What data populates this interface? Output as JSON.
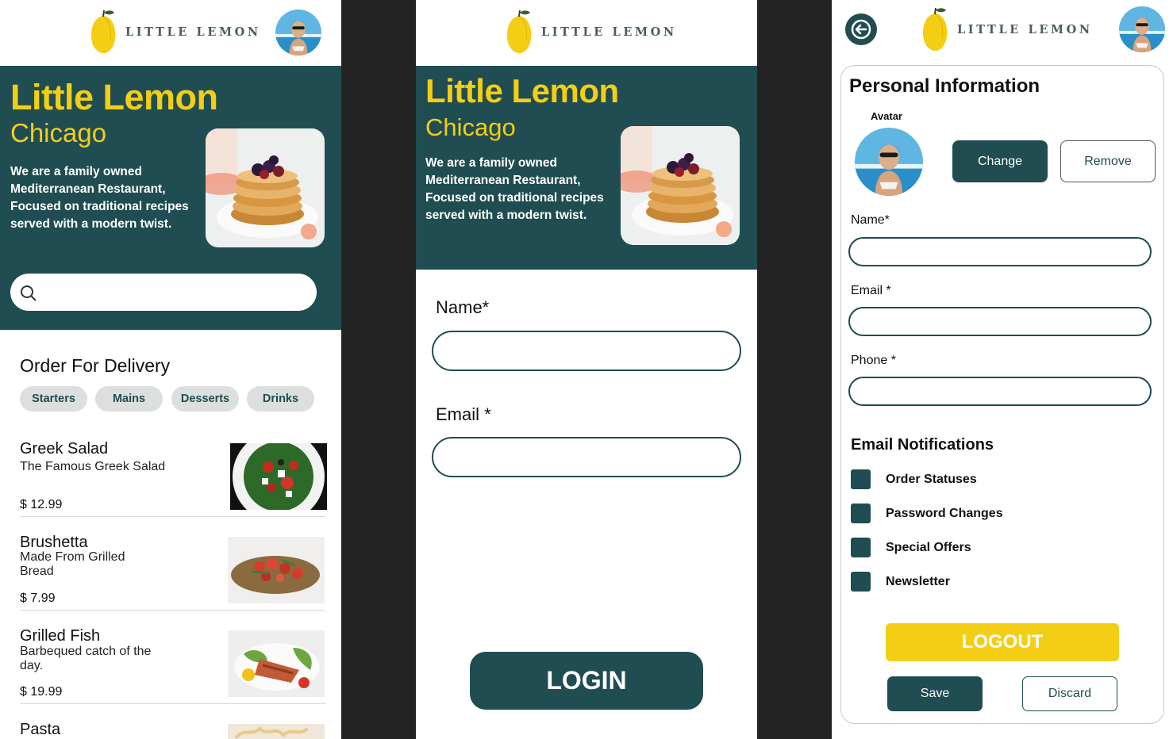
{
  "brand": {
    "logo_text": "LITTLE LEMON",
    "colors": {
      "primary": "#1f4d52",
      "accent": "#f4ce14",
      "light": "#dcdfde"
    }
  },
  "home": {
    "hero": {
      "title": "Little Lemon",
      "subtitle": "Chicago",
      "description": "We are a family owned Mediterranean Restaurant, Focused on traditional recipes served with  a modern twist."
    },
    "search": {
      "placeholder": "",
      "icon": "search-icon"
    },
    "section_title": "Order For Delivery",
    "categories": [
      "Starters",
      "Mains",
      "Desserts",
      "Drinks"
    ],
    "menu": [
      {
        "name": "Greek Salad",
        "description": "The Famous Greek Salad",
        "price": "$ 12.99"
      },
      {
        "name": "Brushetta",
        "description": "Made From Grilled Bread",
        "price": "$ 7.99"
      },
      {
        "name": "Grilled Fish",
        "description": "Barbequed catch of the day.",
        "price": "$ 19.99"
      },
      {
        "name": "Pasta",
        "description": "",
        "price": ""
      }
    ]
  },
  "onboarding": {
    "hero": {
      "title": "Little Lemon",
      "subtitle": "Chicago",
      "description": "We are a family owned Mediterranean Restaurant, Focused on traditional recipes served with  a modern twist."
    },
    "name_label": "Name*",
    "email_label": "Email *",
    "name_value": "",
    "email_value": "",
    "login_label": "LOGIN"
  },
  "profile": {
    "back_icon": "arrow-left-icon",
    "title": "Personal Information",
    "avatar_label": "Avatar",
    "change_label": "Change",
    "remove_label": "Remove",
    "name_label": "Name*",
    "email_label": "Email *",
    "phone_label": "Phone *",
    "name_value": "",
    "email_value": "",
    "phone_value": "",
    "notifications_title": "Email Notifications",
    "notifications": [
      {
        "label": "Order Statuses",
        "checked": true
      },
      {
        "label": "Password Changes",
        "checked": true
      },
      {
        "label": "Special Offers",
        "checked": true
      },
      {
        "label": "Newsletter",
        "checked": true
      }
    ],
    "logout_label": "LOGOUT",
    "save_label": "Save",
    "discard_label": "Discard"
  }
}
